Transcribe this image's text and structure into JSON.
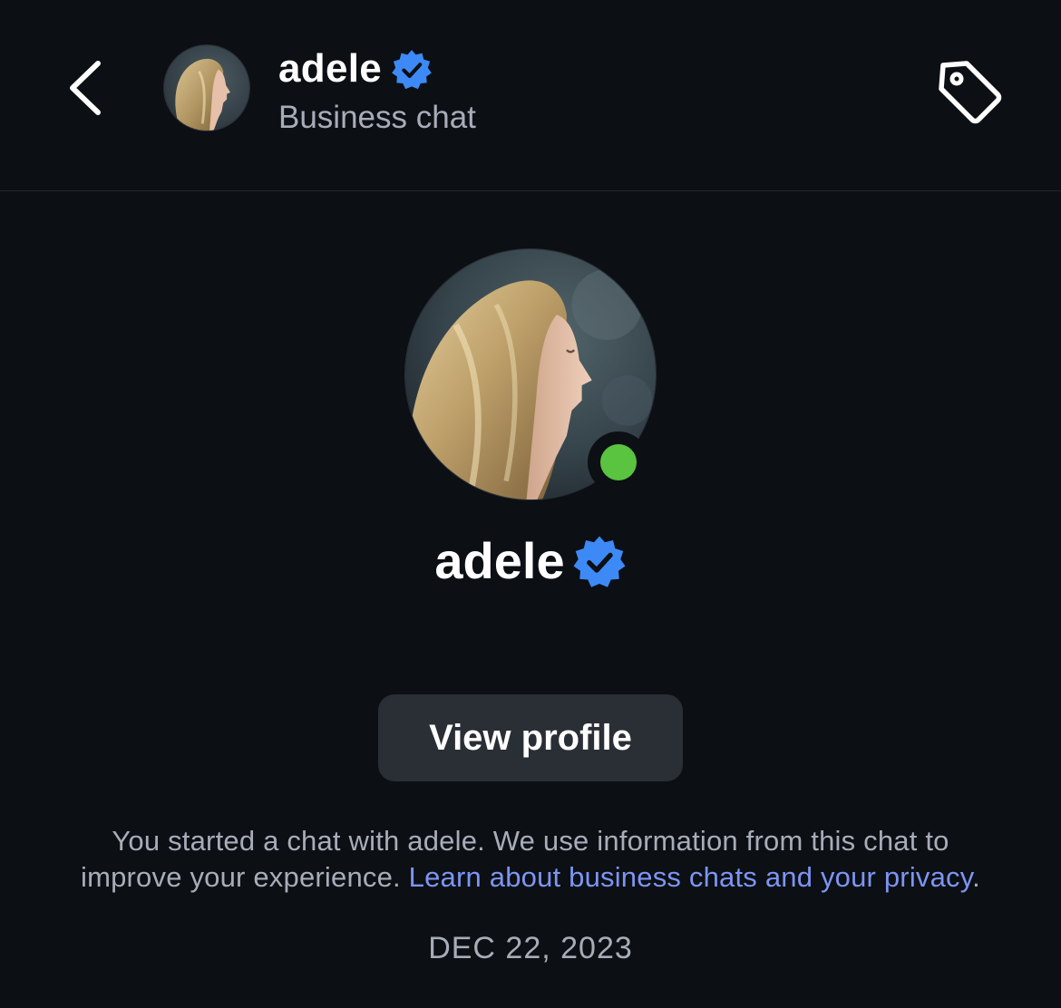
{
  "header": {
    "back_icon": "chevron-left-icon",
    "avatar": "adele-profile-photo",
    "name": "adele",
    "verified_icon": "verified-badge-icon",
    "subtitle": "Business chat",
    "tag_icon": "tag-icon"
  },
  "profile": {
    "avatar": "adele-profile-photo",
    "online_status_icon": "online-status-dot",
    "name": "adele",
    "verified_icon": "verified-badge-icon",
    "view_profile_label": "View profile"
  },
  "notice": {
    "line1": "You started a chat with adele. We use information from this chat to",
    "line2_prefix": "improve your experience. ",
    "link_text": "Learn about business chats and your privacy",
    "line2_suffix": "."
  },
  "date_separator": "DEC 22, 2023",
  "colors": {
    "background": "#0c0f14",
    "verified_blue": "#3d8af7",
    "online_green": "#5ac33f",
    "link_blue": "#7d95f2",
    "button_bg": "#2a2e35",
    "secondary_text": "#a7adb8"
  }
}
